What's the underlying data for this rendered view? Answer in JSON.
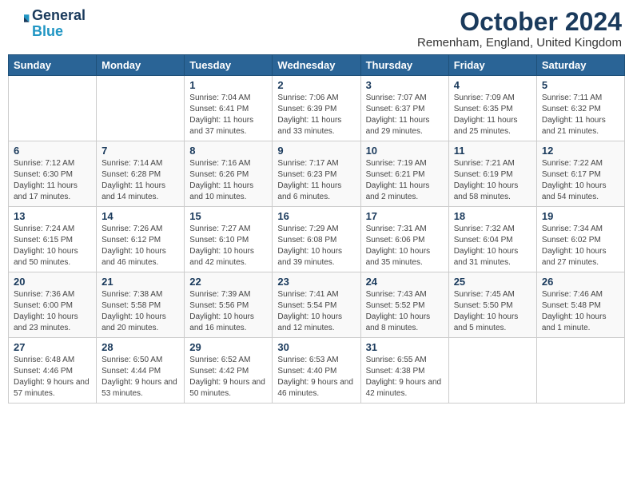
{
  "header": {
    "logo_line1": "General",
    "logo_line2": "Blue",
    "month_year": "October 2024",
    "location": "Remenham, England, United Kingdom"
  },
  "weekdays": [
    "Sunday",
    "Monday",
    "Tuesday",
    "Wednesday",
    "Thursday",
    "Friday",
    "Saturday"
  ],
  "weeks": [
    [
      {
        "date": "",
        "info": ""
      },
      {
        "date": "",
        "info": ""
      },
      {
        "date": "1",
        "info": "Sunrise: 7:04 AM\nSunset: 6:41 PM\nDaylight: 11 hours and 37 minutes."
      },
      {
        "date": "2",
        "info": "Sunrise: 7:06 AM\nSunset: 6:39 PM\nDaylight: 11 hours and 33 minutes."
      },
      {
        "date": "3",
        "info": "Sunrise: 7:07 AM\nSunset: 6:37 PM\nDaylight: 11 hours and 29 minutes."
      },
      {
        "date": "4",
        "info": "Sunrise: 7:09 AM\nSunset: 6:35 PM\nDaylight: 11 hours and 25 minutes."
      },
      {
        "date": "5",
        "info": "Sunrise: 7:11 AM\nSunset: 6:32 PM\nDaylight: 11 hours and 21 minutes."
      }
    ],
    [
      {
        "date": "6",
        "info": "Sunrise: 7:12 AM\nSunset: 6:30 PM\nDaylight: 11 hours and 17 minutes."
      },
      {
        "date": "7",
        "info": "Sunrise: 7:14 AM\nSunset: 6:28 PM\nDaylight: 11 hours and 14 minutes."
      },
      {
        "date": "8",
        "info": "Sunrise: 7:16 AM\nSunset: 6:26 PM\nDaylight: 11 hours and 10 minutes."
      },
      {
        "date": "9",
        "info": "Sunrise: 7:17 AM\nSunset: 6:23 PM\nDaylight: 11 hours and 6 minutes."
      },
      {
        "date": "10",
        "info": "Sunrise: 7:19 AM\nSunset: 6:21 PM\nDaylight: 11 hours and 2 minutes."
      },
      {
        "date": "11",
        "info": "Sunrise: 7:21 AM\nSunset: 6:19 PM\nDaylight: 10 hours and 58 minutes."
      },
      {
        "date": "12",
        "info": "Sunrise: 7:22 AM\nSunset: 6:17 PM\nDaylight: 10 hours and 54 minutes."
      }
    ],
    [
      {
        "date": "13",
        "info": "Sunrise: 7:24 AM\nSunset: 6:15 PM\nDaylight: 10 hours and 50 minutes."
      },
      {
        "date": "14",
        "info": "Sunrise: 7:26 AM\nSunset: 6:12 PM\nDaylight: 10 hours and 46 minutes."
      },
      {
        "date": "15",
        "info": "Sunrise: 7:27 AM\nSunset: 6:10 PM\nDaylight: 10 hours and 42 minutes."
      },
      {
        "date": "16",
        "info": "Sunrise: 7:29 AM\nSunset: 6:08 PM\nDaylight: 10 hours and 39 minutes."
      },
      {
        "date": "17",
        "info": "Sunrise: 7:31 AM\nSunset: 6:06 PM\nDaylight: 10 hours and 35 minutes."
      },
      {
        "date": "18",
        "info": "Sunrise: 7:32 AM\nSunset: 6:04 PM\nDaylight: 10 hours and 31 minutes."
      },
      {
        "date": "19",
        "info": "Sunrise: 7:34 AM\nSunset: 6:02 PM\nDaylight: 10 hours and 27 minutes."
      }
    ],
    [
      {
        "date": "20",
        "info": "Sunrise: 7:36 AM\nSunset: 6:00 PM\nDaylight: 10 hours and 23 minutes."
      },
      {
        "date": "21",
        "info": "Sunrise: 7:38 AM\nSunset: 5:58 PM\nDaylight: 10 hours and 20 minutes."
      },
      {
        "date": "22",
        "info": "Sunrise: 7:39 AM\nSunset: 5:56 PM\nDaylight: 10 hours and 16 minutes."
      },
      {
        "date": "23",
        "info": "Sunrise: 7:41 AM\nSunset: 5:54 PM\nDaylight: 10 hours and 12 minutes."
      },
      {
        "date": "24",
        "info": "Sunrise: 7:43 AM\nSunset: 5:52 PM\nDaylight: 10 hours and 8 minutes."
      },
      {
        "date": "25",
        "info": "Sunrise: 7:45 AM\nSunset: 5:50 PM\nDaylight: 10 hours and 5 minutes."
      },
      {
        "date": "26",
        "info": "Sunrise: 7:46 AM\nSunset: 5:48 PM\nDaylight: 10 hours and 1 minute."
      }
    ],
    [
      {
        "date": "27",
        "info": "Sunrise: 6:48 AM\nSunset: 4:46 PM\nDaylight: 9 hours and 57 minutes."
      },
      {
        "date": "28",
        "info": "Sunrise: 6:50 AM\nSunset: 4:44 PM\nDaylight: 9 hours and 53 minutes."
      },
      {
        "date": "29",
        "info": "Sunrise: 6:52 AM\nSunset: 4:42 PM\nDaylight: 9 hours and 50 minutes."
      },
      {
        "date": "30",
        "info": "Sunrise: 6:53 AM\nSunset: 4:40 PM\nDaylight: 9 hours and 46 minutes."
      },
      {
        "date": "31",
        "info": "Sunrise: 6:55 AM\nSunset: 4:38 PM\nDaylight: 9 hours and 42 minutes."
      },
      {
        "date": "",
        "info": ""
      },
      {
        "date": "",
        "info": ""
      }
    ]
  ]
}
